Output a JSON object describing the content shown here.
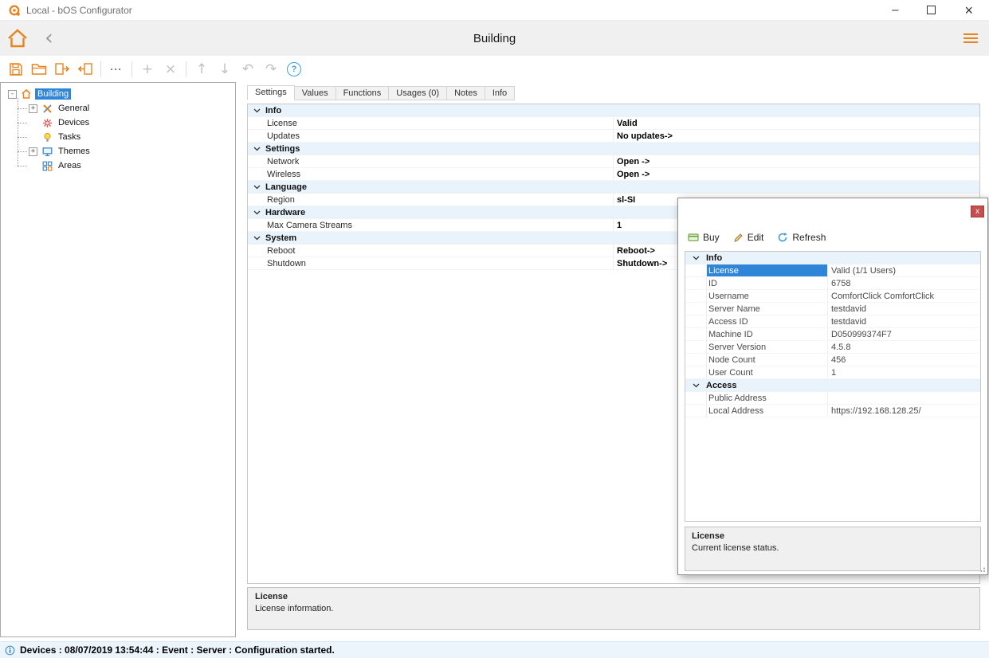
{
  "window": {
    "title": "Local - bOS Configurator",
    "minimize_glyph": "–",
    "close_glyph": "×"
  },
  "header": {
    "title": "Building"
  },
  "toolbar_glyphs": {
    "ellipsis": "···",
    "add": "+",
    "delete": "×",
    "move_up": "↑",
    "move_down": "↓",
    "undo": "↶",
    "redo": "↷",
    "help": "?"
  },
  "tabs": [
    {
      "label": "Settings",
      "active": true
    },
    {
      "label": "Values",
      "active": false
    },
    {
      "label": "Functions",
      "active": false
    },
    {
      "label": "Usages (0)",
      "active": false
    },
    {
      "label": "Notes",
      "active": false
    },
    {
      "label": "Info",
      "active": false
    }
  ],
  "tree": {
    "root": {
      "label": "Building",
      "icon": "building-icon",
      "expander": "-",
      "selected": true
    },
    "children": [
      {
        "label": "General",
        "icon": "general-icon",
        "expander": "+"
      },
      {
        "label": "Devices",
        "icon": "devices-icon",
        "expander": ""
      },
      {
        "label": "Tasks",
        "icon": "tasks-icon",
        "expander": ""
      },
      {
        "label": "Themes",
        "icon": "themes-icon",
        "expander": "+"
      },
      {
        "label": "Areas",
        "icon": "areas-icon",
        "expander": ""
      }
    ]
  },
  "settings_grid": {
    "groups": [
      {
        "label": "Info",
        "rows": [
          {
            "name": "License",
            "value": "Valid"
          },
          {
            "name": "Updates",
            "value": "No updates->"
          }
        ]
      },
      {
        "label": "Settings",
        "rows": [
          {
            "name": "Network",
            "value": "Open ->"
          },
          {
            "name": "Wireless",
            "value": "Open ->"
          }
        ]
      },
      {
        "label": "Language",
        "rows": [
          {
            "name": "Region",
            "value": "sl-SI"
          }
        ]
      },
      {
        "label": "Hardware",
        "rows": [
          {
            "name": "Max Camera Streams",
            "value": "1"
          }
        ]
      },
      {
        "label": "System",
        "rows": [
          {
            "name": "Reboot",
            "value": "Reboot->"
          },
          {
            "name": "Shutdown",
            "value": "Shutdown->"
          }
        ]
      }
    ]
  },
  "main_description": {
    "title": "License",
    "text": "License information."
  },
  "popup": {
    "close_glyph": "x",
    "toolbar": [
      {
        "name": "buy",
        "label": "Buy"
      },
      {
        "name": "edit",
        "label": "Edit"
      },
      {
        "name": "refresh",
        "label": "Refresh"
      }
    ],
    "grid": {
      "groups": [
        {
          "label": "Info",
          "rows": [
            {
              "name": "License",
              "value": "Valid (1/1 Users)",
              "selected": true
            },
            {
              "name": "ID",
              "value": "6758"
            },
            {
              "name": "Username",
              "value": "ComfortClick ComfortClick"
            },
            {
              "name": "Server Name",
              "value": "testdavid"
            },
            {
              "name": "Access ID",
              "value": "testdavid"
            },
            {
              "name": "Machine ID",
              "value": "D050999374F7"
            },
            {
              "name": "Server Version",
              "value": "4.5.8"
            },
            {
              "name": "Node Count",
              "value": "456"
            },
            {
              "name": "User Count",
              "value": "1"
            }
          ]
        },
        {
          "label": "Access",
          "rows": [
            {
              "name": "Public Address",
              "value": ""
            },
            {
              "name": "Local Address",
              "value": "https://192.168.128.25/"
            }
          ]
        }
      ]
    },
    "description": {
      "title": "License",
      "text": "Current license status."
    }
  },
  "statusbar": {
    "text": "Devices : 08/07/2019 13:54:44 : Event : Server : Configuration started."
  },
  "colors": {
    "accent_orange": "#e8831d",
    "selection_blue": "#2f86d8",
    "group_row_bg": "#e9f3fb",
    "close_red": "#c64f4d"
  }
}
